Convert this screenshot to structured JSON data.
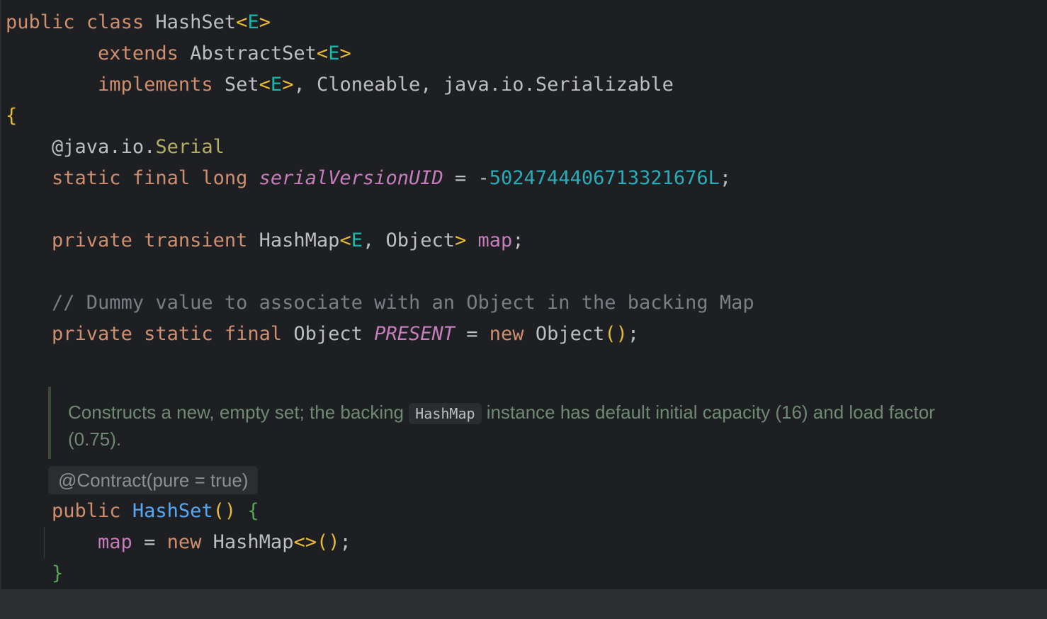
{
  "code": {
    "l1": [
      "public",
      "class",
      "HashSet",
      "<",
      "E",
      ">"
    ],
    "l2": [
      "extends",
      "AbstractSet",
      "<",
      "E",
      ">"
    ],
    "l3": [
      "implements",
      "Set",
      "<",
      "E",
      ">",
      ", Cloneable, java.io.Serializable"
    ],
    "l4": "{",
    "l5": [
      "@java.io.",
      "Serial"
    ],
    "l6": [
      "static final long",
      "serialVersionUID",
      " = ",
      "-",
      "5024744406713321676L",
      ";"
    ],
    "l8": [
      "private transient",
      "HashMap",
      "<",
      "E",
      ", Object",
      ">",
      "map",
      ";"
    ],
    "l10": "// Dummy value to associate with an Object in the backing Map",
    "l11": [
      "private static final",
      "Object",
      "PRESENT",
      " = ",
      "new",
      "Object",
      "()",
      ";"
    ],
    "l15": [
      "public",
      "HashSet",
      "()",
      "{"
    ],
    "l16": [
      "map",
      " = ",
      "new",
      "HashMap",
      "<>",
      "()",
      ";"
    ],
    "l17": "}"
  },
  "doc": {
    "before": "Constructs a new, empty set; the backing ",
    "chip": "HashMap",
    "after": " instance has default initial capacity (16) and load factor (0.75)."
  },
  "contract": "@Contract(pure = true)"
}
